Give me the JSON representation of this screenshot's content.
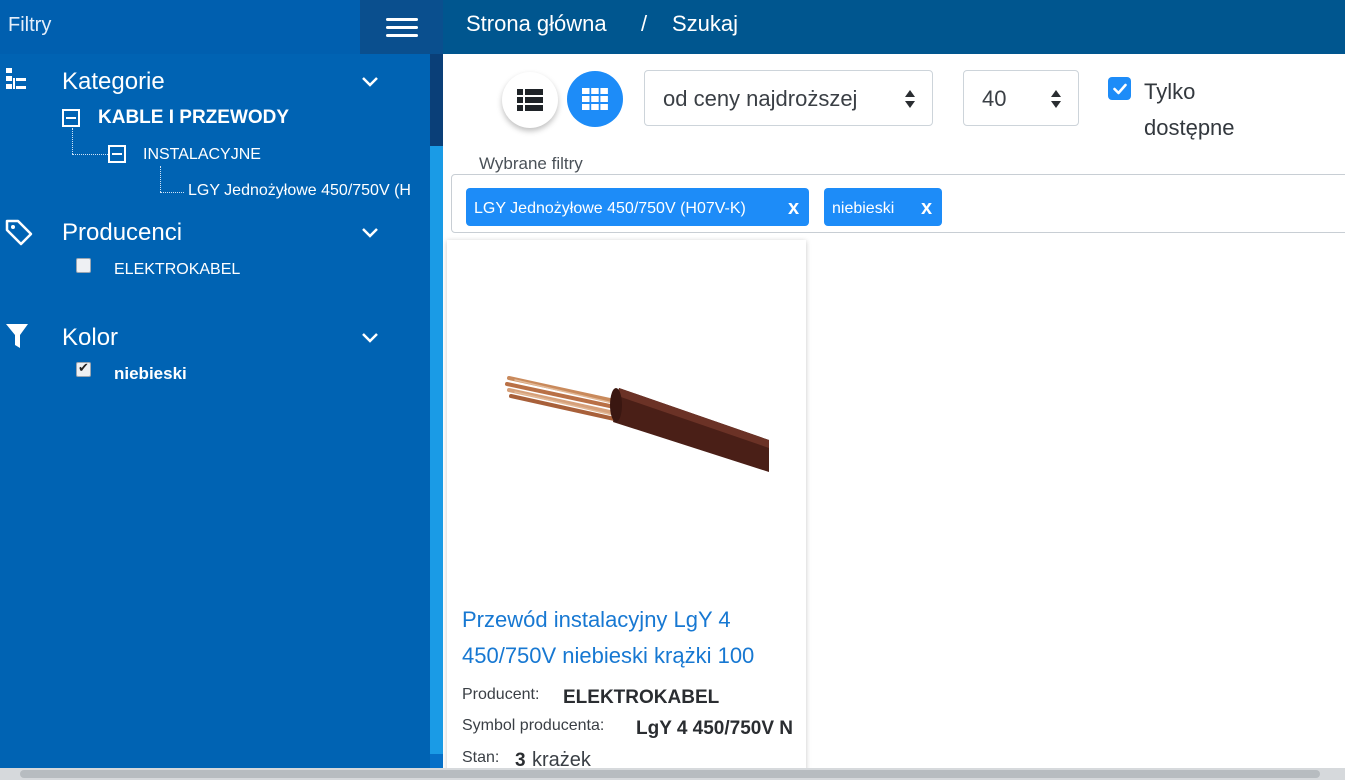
{
  "sidebar": {
    "title": "Filtry",
    "sections": {
      "categories": {
        "label": "Kategorie",
        "tree": {
          "level1": "KABLE I PRZEWODY",
          "level2": "INSTALACYJNE",
          "level3": "LGY Jednożyłowe 450/750V (H"
        }
      },
      "producers": {
        "label": "Producenci",
        "items": [
          {
            "label": "ELEKTROKABEL",
            "checked": false
          }
        ]
      },
      "color": {
        "label": "Kolor",
        "items": [
          {
            "label": "niebieski",
            "checked": true
          }
        ]
      }
    }
  },
  "breadcrumb": {
    "home": "Strona główna",
    "separator": "/",
    "current": "Szukaj"
  },
  "toolbar": {
    "sort": {
      "selected": "od ceny najdroższej"
    },
    "per_page": {
      "selected": "40"
    },
    "only_available": {
      "label": "Tylko dostępne",
      "checked": true
    }
  },
  "selected_filters": {
    "legend": "Wybrane filtry",
    "tags": [
      {
        "label": "LGY Jednożyłowe 450/750V (H07V-K)",
        "remove": "x"
      },
      {
        "label": "niebieski",
        "remove": "x"
      }
    ]
  },
  "product": {
    "title": "Przewód instalacyjny LgY 4 450/750V niebieski krążki 100",
    "producer_label": "Producent:",
    "producer_value": "ELEKTROKABEL",
    "symbol_label": "Symbol producenta:",
    "symbol_value": "LgY 4 450/750V N",
    "stock_label": "Stan:",
    "stock_qty": "3",
    "stock_unit": "krażek"
  },
  "colors": {
    "sidebar_bg": "#0063b3",
    "topbar_bg": "#00568f",
    "accent": "#1d8cf8",
    "link": "#1778d2"
  },
  "icons": {
    "categories": "tree-icon",
    "producers": "tag-icon",
    "color": "filter-icon",
    "menu": "hamburger-icon",
    "view_list": "list-view-icon",
    "view_grid": "grid-view-icon"
  }
}
